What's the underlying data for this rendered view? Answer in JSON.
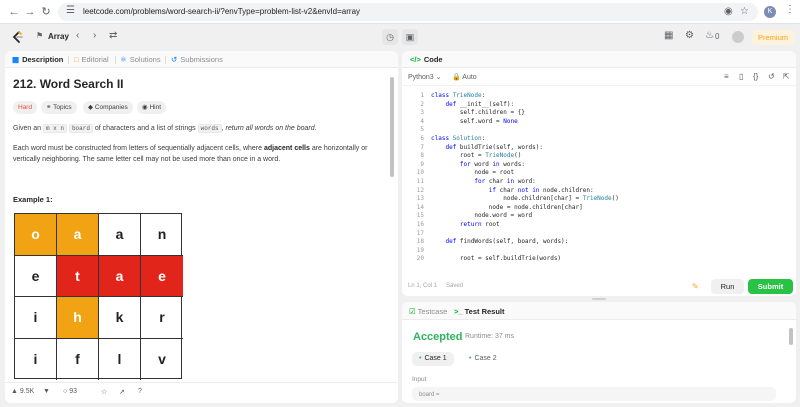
{
  "browser": {
    "url": "leetcode.com/problems/word-search-ii/?envType=problem-list-v2&envId=array",
    "profile_initial": "K"
  },
  "topbar": {
    "problem_list_label": "Array",
    "notification_count": "0",
    "premium_label": "Premium"
  },
  "left_tabs": [
    "Description",
    "Editorial",
    "Solutions",
    "Submissions"
  ],
  "problem": {
    "title": "212. Word Search II",
    "difficulty": "Hard",
    "tags": [
      "Topics",
      "Companies",
      "Hint"
    ],
    "p1_a": "Given an ",
    "p1_code1": "m x n",
    "p1_b": " ",
    "p1_code2": "board",
    "p1_c": " of characters and a list of strings ",
    "p1_code3": "words",
    "p1_d": ", ",
    "p1_italic": "return all words on the board",
    "p1_e": ".",
    "p2_a": "Each word must be constructed from letters of sequentially adjacent cells, where ",
    "p2_bold": "adjacent cells",
    "p2_b": " are horizontally or vertically neighboring. The same letter cell may not be used more than once in a word.",
    "example_heading": "Example 1:",
    "board": [
      [
        {
          "ch": "o",
          "hl": "y"
        },
        {
          "ch": "a",
          "hl": "y"
        },
        {
          "ch": "a",
          "hl": ""
        },
        {
          "ch": "n",
          "hl": ""
        }
      ],
      [
        {
          "ch": "e",
          "hl": ""
        },
        {
          "ch": "t",
          "hl": "r"
        },
        {
          "ch": "a",
          "hl": "r"
        },
        {
          "ch": "e",
          "hl": "r"
        }
      ],
      [
        {
          "ch": "i",
          "hl": ""
        },
        {
          "ch": "h",
          "hl": "y"
        },
        {
          "ch": "k",
          "hl": ""
        },
        {
          "ch": "r",
          "hl": ""
        }
      ],
      [
        {
          "ch": "i",
          "hl": ""
        },
        {
          "ch": "f",
          "hl": ""
        },
        {
          "ch": "l",
          "hl": ""
        },
        {
          "ch": "v",
          "hl": ""
        }
      ]
    ],
    "colors": {
      "y": "#f2a314",
      "r": "#e1251b"
    }
  },
  "footer": {
    "likes": "9.5K",
    "comments": "93"
  },
  "code_panel": {
    "title": "Code",
    "language": "Python3",
    "mode": "Auto",
    "status_left": "Ln 1, Col 1",
    "status_saved": "Saved",
    "lines": [
      {
        "n": "1",
        "t": "class TrieNode:"
      },
      {
        "n": "2",
        "t": "    def __init__(self):"
      },
      {
        "n": "3",
        "t": "        self.children = {}"
      },
      {
        "n": "4",
        "t": "        self.word = None"
      },
      {
        "n": "5",
        "t": ""
      },
      {
        "n": "6",
        "t": "class Solution:"
      },
      {
        "n": "7",
        "t": "    def buildTrie(self, words):"
      },
      {
        "n": "8",
        "t": "        root = TrieNode()"
      },
      {
        "n": "9",
        "t": "        for word in words:"
      },
      {
        "n": "10",
        "t": "            node = root"
      },
      {
        "n": "11",
        "t": "            for char in word:"
      },
      {
        "n": "12",
        "t": "                if char not in node.children:"
      },
      {
        "n": "13",
        "t": "                    node.children[char] = TrieNode()"
      },
      {
        "n": "14",
        "t": "                node = node.children[char]"
      },
      {
        "n": "15",
        "t": "            node.word = word"
      },
      {
        "n": "16",
        "t": "        return root"
      },
      {
        "n": "17",
        "t": ""
      },
      {
        "n": "18",
        "t": "    def findWords(self, board, words):"
      },
      {
        "n": "19",
        "t": ""
      },
      {
        "n": "20",
        "t": "        root = self.buildTrie(words)"
      }
    ],
    "run_label": "Run",
    "submit_label": "Submit"
  },
  "result_panel": {
    "tabs": [
      "Testcase",
      "Test Result"
    ],
    "status": "Accepted",
    "runtime": "Runtime: 37 ms",
    "cases": [
      "Case 1",
      "Case 2"
    ],
    "input_label": "Input",
    "input_var": "board ="
  }
}
